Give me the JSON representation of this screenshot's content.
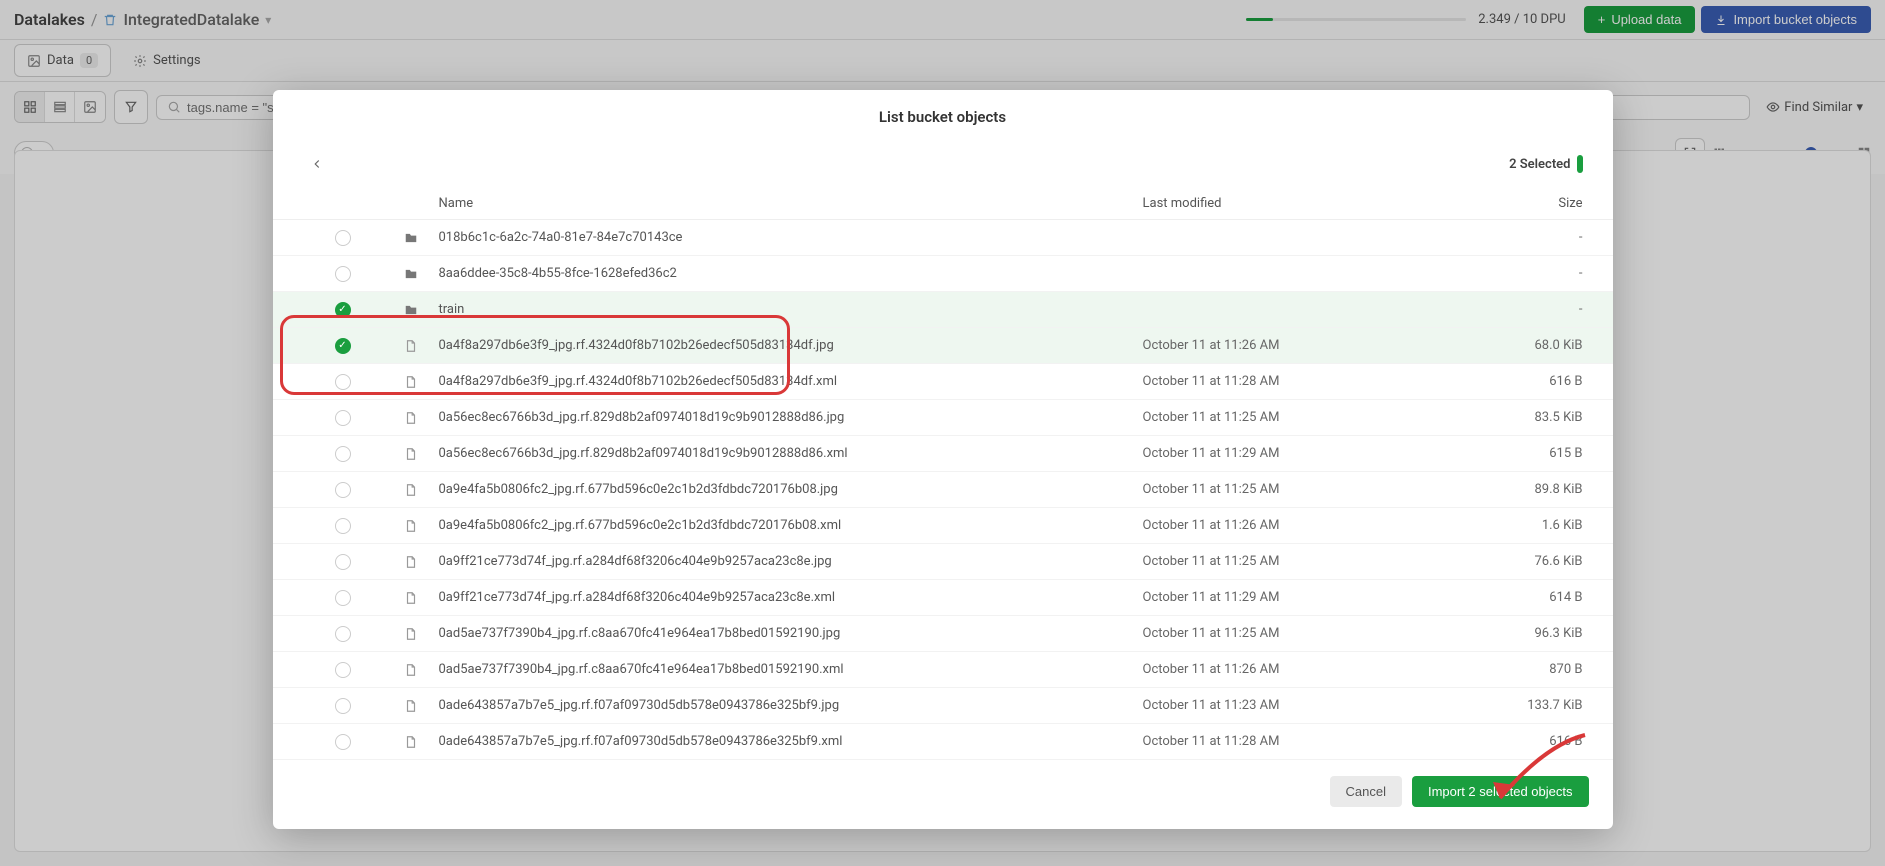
{
  "breadcrumb": {
    "root": "Datalakes",
    "sep": "/",
    "name": "IntegratedDatalake"
  },
  "dpu": "2.349 / 10 DPU",
  "buttons": {
    "upload": "Upload data",
    "import_bucket": "Import bucket objects"
  },
  "tabs": {
    "data": "Data",
    "data_count": "0",
    "settings": "Settings"
  },
  "search": {
    "placeholder": "tags.name = \"summer\""
  },
  "findsimilar": "Find Similar",
  "modal": {
    "title": "List bucket objects",
    "selected": "2 Selected",
    "columns": {
      "name": "Name",
      "last_modified": "Last modified",
      "size": "Size"
    },
    "rows": [
      {
        "selected": false,
        "type": "folder",
        "name": "018b6c1c-6a2c-74a0-81e7-84e7c70143ce",
        "last_modified": "",
        "size": "-"
      },
      {
        "selected": false,
        "type": "folder",
        "name": "8aa6ddee-35c8-4b55-8fce-1628efed36c2",
        "last_modified": "",
        "size": "-"
      },
      {
        "selected": true,
        "type": "folder",
        "name": "train",
        "last_modified": "",
        "size": "-"
      },
      {
        "selected": true,
        "type": "file",
        "name": "0a4f8a297db6e3f9_jpg.rf.4324d0f8b7102b26edecf505d83134df.jpg",
        "last_modified": "October 11 at 11:26 AM",
        "size": "68.0 KiB"
      },
      {
        "selected": false,
        "type": "file",
        "name": "0a4f8a297db6e3f9_jpg.rf.4324d0f8b7102b26edecf505d83134df.xml",
        "last_modified": "October 11 at 11:28 AM",
        "size": "616 B"
      },
      {
        "selected": false,
        "type": "file",
        "name": "0a56ec8ec6766b3d_jpg.rf.829d8b2af0974018d19c9b9012888d86.jpg",
        "last_modified": "October 11 at 11:25 AM",
        "size": "83.5 KiB"
      },
      {
        "selected": false,
        "type": "file",
        "name": "0a56ec8ec6766b3d_jpg.rf.829d8b2af0974018d19c9b9012888d86.xml",
        "last_modified": "October 11 at 11:29 AM",
        "size": "615 B"
      },
      {
        "selected": false,
        "type": "file",
        "name": "0a9e4fa5b0806fc2_jpg.rf.677bd596c0e2c1b2d3fdbdc720176b08.jpg",
        "last_modified": "October 11 at 11:25 AM",
        "size": "89.8 KiB"
      },
      {
        "selected": false,
        "type": "file",
        "name": "0a9e4fa5b0806fc2_jpg.rf.677bd596c0e2c1b2d3fdbdc720176b08.xml",
        "last_modified": "October 11 at 11:26 AM",
        "size": "1.6 KiB"
      },
      {
        "selected": false,
        "type": "file",
        "name": "0a9ff21ce773d74f_jpg.rf.a284df68f3206c404e9b9257aca23c8e.jpg",
        "last_modified": "October 11 at 11:25 AM",
        "size": "76.6 KiB"
      },
      {
        "selected": false,
        "type": "file",
        "name": "0a9ff21ce773d74f_jpg.rf.a284df68f3206c404e9b9257aca23c8e.xml",
        "last_modified": "October 11 at 11:29 AM",
        "size": "614 B"
      },
      {
        "selected": false,
        "type": "file",
        "name": "0ad5ae737f7390b4_jpg.rf.c8aa670fc41e964ea17b8bed01592190.jpg",
        "last_modified": "October 11 at 11:25 AM",
        "size": "96.3 KiB"
      },
      {
        "selected": false,
        "type": "file",
        "name": "0ad5ae737f7390b4_jpg.rf.c8aa670fc41e964ea17b8bed01592190.xml",
        "last_modified": "October 11 at 11:26 AM",
        "size": "870 B"
      },
      {
        "selected": false,
        "type": "file",
        "name": "0ade643857a7b7e5_jpg.rf.f07af09730d5db578e0943786e325bf9.jpg",
        "last_modified": "October 11 at 11:23 AM",
        "size": "133.7 KiB"
      },
      {
        "selected": false,
        "type": "file",
        "name": "0ade643857a7b7e5_jpg.rf.f07af09730d5db578e0943786e325bf9.xml",
        "last_modified": "October 11 at 11:28 AM",
        "size": "616 B"
      }
    ],
    "cancel": "Cancel",
    "import": "Import 2 selected objects"
  }
}
